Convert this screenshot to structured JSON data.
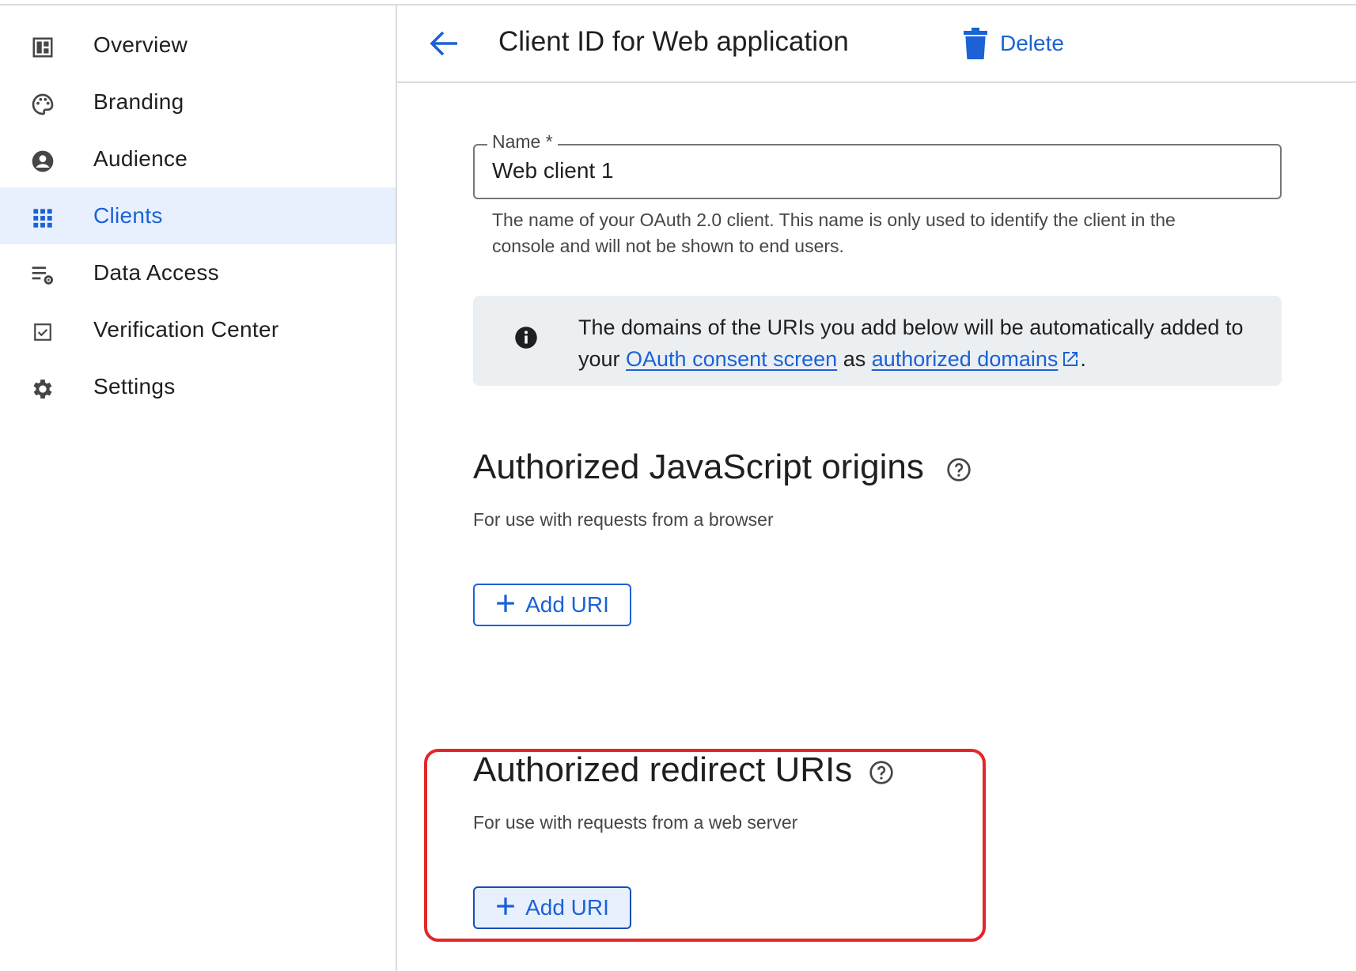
{
  "sidebar": {
    "items": [
      {
        "label": "Overview",
        "icon": "dashboard-icon",
        "active": false
      },
      {
        "label": "Branding",
        "icon": "palette-icon",
        "active": false
      },
      {
        "label": "Audience",
        "icon": "account-circle-icon",
        "active": false
      },
      {
        "label": "Clients",
        "icon": "apps-grid-icon",
        "active": true
      },
      {
        "label": "Data Access",
        "icon": "list-settings-icon",
        "active": false
      },
      {
        "label": "Verification Center",
        "icon": "checkbox-icon",
        "active": false
      },
      {
        "label": "Settings",
        "icon": "gear-icon",
        "active": false
      }
    ]
  },
  "header": {
    "back_icon": "arrow-back-icon",
    "title": "Client ID for Web application",
    "delete_label": "Delete",
    "delete_icon": "trash-icon"
  },
  "name_field": {
    "label": "Name *",
    "value": "Web client 1",
    "help": "The name of your OAuth 2.0 client. This name is only used to identify the client in the console and will not be shown to end users."
  },
  "info_banner": {
    "icon": "info-icon",
    "text_before": "The domains of the URIs you add below will be automatically added to your ",
    "link1": "OAuth consent screen",
    "text_middle": " as ",
    "link2": "authorized domains",
    "text_after": "."
  },
  "js_origins": {
    "title": "Authorized JavaScript origins",
    "subtitle": "For use with requests from a browser",
    "button_label": "Add URI"
  },
  "redirect_uris": {
    "title": "Authorized redirect URIs",
    "subtitle": "For use with requests from a web server",
    "button_label": "Add URI"
  },
  "colors": {
    "accent": "#1a62d6",
    "active_bg": "#e8f0fe",
    "highlight": "#e3262a"
  }
}
